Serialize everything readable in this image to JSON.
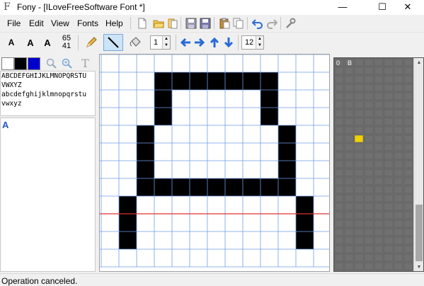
{
  "window": {
    "title": "Fony - [ILoveFreeSoftware Font *]",
    "app_icon": "F",
    "minimize": "—",
    "maximize": "☐",
    "close": "✕"
  },
  "menu": {
    "items": [
      "File",
      "Edit",
      "View",
      "Fonts",
      "Help"
    ]
  },
  "toolbar": {
    "icons": [
      "new-file-icon",
      "open-folder-icon",
      "open-file-icon",
      "save-icon",
      "save-as-icon",
      "paste-icon",
      "copy-icon",
      "undo-icon",
      "redo-icon",
      "wrench-icon"
    ]
  },
  "tools": {
    "letter_a_1": "A",
    "letter_a_2": "A",
    "letter_a_3": "A",
    "coord_x": "65",
    "coord_y": "41",
    "pen_size": "1",
    "zoom": "12"
  },
  "left_panel": {
    "preview_lines": [
      "ABCDEFGHIJKLMNOPQRSTU",
      "VWXYZ",
      "abcdefghijklmnopqrstu",
      "vwxyz"
    ],
    "glyph_entry": "A"
  },
  "right_panel": {
    "header_labels": [
      "0",
      "B"
    ]
  },
  "colors": {
    "grid_line": "#6f9de8",
    "baseline": "#e03030",
    "pixel_on": "#000000",
    "charmap_cell": "#707070",
    "charmap_highlight": "#f0d000"
  },
  "status": {
    "text": "Operation canceled."
  }
}
